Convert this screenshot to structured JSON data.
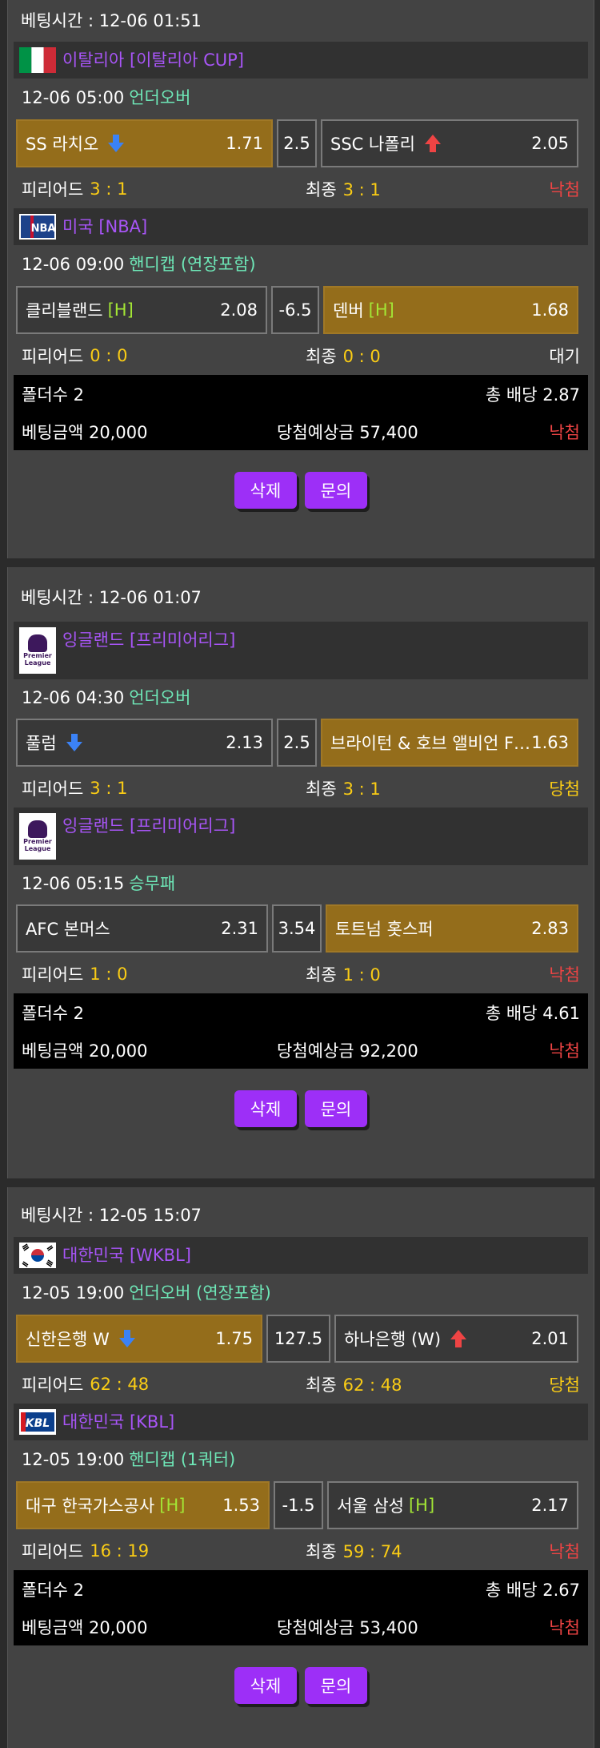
{
  "bets": [
    {
      "time": "베팅시간 : 12-06 01:51",
      "matches": [
        {
          "league": "이탈리아 [이탈리아 CUP]",
          "datetime": "12-06 05:00",
          "market": "언더오버",
          "home": {
            "name": "SS 라치오",
            "tag": "",
            "odds": "1.71",
            "icon": "arrow-down-icon"
          },
          "line": "2.5",
          "away": {
            "name": "SSC 나폴리",
            "tag": "",
            "odds": "2.05",
            "icon": "arrow-up-icon"
          },
          "period_label": "피리어드",
          "period_score": "3 : 1",
          "final_label": "최종",
          "final_score": "3 : 1",
          "result": "낙첨"
        },
        {
          "league": "미국 [NBA]",
          "datetime": "12-06 09:00",
          "market": "핸디캡 (연장포함)",
          "home": {
            "name": "클리블랜드",
            "tag": "[H]",
            "odds": "2.08",
            "icon": ""
          },
          "line": "-6.5",
          "away": {
            "name": "덴버",
            "tag": "[H]",
            "odds": "1.68",
            "icon": ""
          },
          "period_label": "피리어드",
          "period_score": "0 : 0",
          "final_label": "최종",
          "final_score": "0 : 0",
          "result": "대기"
        }
      ],
      "folder_label": "폴더수 2",
      "total_odds": "총 배당 2.87",
      "amount": "베팅금액 20,000",
      "expected": "당첨예상금 57,400",
      "status": "낙첨"
    },
    {
      "time": "베팅시간 : 12-06 01:07",
      "matches": [
        {
          "league": "잉글랜드 [프리미어리그]",
          "datetime": "12-06 04:30",
          "market": "언더오버",
          "home": {
            "name": "풀럼",
            "tag": "",
            "odds": "2.13",
            "icon": "arrow-down-icon"
          },
          "line": "2.5",
          "away": {
            "name": "브라이턴 & 호브 앨비언 F…",
            "tag": "",
            "odds": "1.63",
            "icon": ""
          },
          "period_label": "피리어드",
          "period_score": "3 : 1",
          "final_label": "최종",
          "final_score": "3 : 1",
          "result": "당첨"
        },
        {
          "league": "잉글랜드 [프리미어리그]",
          "datetime": "12-06 05:15",
          "market": "승무패",
          "home": {
            "name": "AFC 본머스",
            "tag": "",
            "odds": "2.31",
            "icon": ""
          },
          "line": "3.54",
          "away": {
            "name": "토트넘 홋스퍼",
            "tag": "",
            "odds": "2.83",
            "icon": ""
          },
          "period_label": "피리어드",
          "period_score": "1 : 0",
          "final_label": "최종",
          "final_score": "1 : 0",
          "result": "낙첨"
        }
      ],
      "folder_label": "폴더수 2",
      "total_odds": "총 배당 4.61",
      "amount": "베팅금액 20,000",
      "expected": "당첨예상금 92,200",
      "status": "낙첨"
    },
    {
      "time": "베팅시간 : 12-05 15:07",
      "matches": [
        {
          "league": "대한민국 [WKBL]",
          "datetime": "12-05 19:00",
          "market": "언더오버 (연장포함)",
          "home": {
            "name": "신한은행 W",
            "tag": "",
            "odds": "1.75",
            "icon": "arrow-down-icon"
          },
          "line": "127.5",
          "away": {
            "name": "하나은행 (W)",
            "tag": "",
            "odds": "2.01",
            "icon": "arrow-up-icon"
          },
          "period_label": "피리어드",
          "period_score": "62 : 48",
          "final_label": "최종",
          "final_score": "62 : 48",
          "result": "당첨"
        },
        {
          "league": "대한민국 [KBL]",
          "datetime": "12-05 19:00",
          "market": "핸디캡 (1쿼터)",
          "home": {
            "name": "대구 한국가스공사",
            "tag": "[H]",
            "odds": "1.53",
            "icon": ""
          },
          "line": "-1.5",
          "away": {
            "name": "서울 삼성",
            "tag": "[H]",
            "odds": "2.17",
            "icon": ""
          },
          "period_label": "피리어드",
          "period_score": "16 : 19",
          "final_label": "최종",
          "final_score": "59 : 74",
          "result": "낙첨"
        }
      ],
      "folder_label": "폴더수 2",
      "total_odds": "총 배당 2.67",
      "amount": "베팅금액 20,000",
      "expected": "당첨예상금 53,400",
      "status": "낙첨"
    }
  ],
  "buttons": {
    "delete": "삭제",
    "inquiry": "문의"
  },
  "colors": {
    "selected_odds": "#946d1b",
    "lose": "#ef4444",
    "win": "#facc15",
    "league_text": "#a855f7",
    "market_text": "#6ee7b7",
    "button": "#9d2ff7"
  }
}
